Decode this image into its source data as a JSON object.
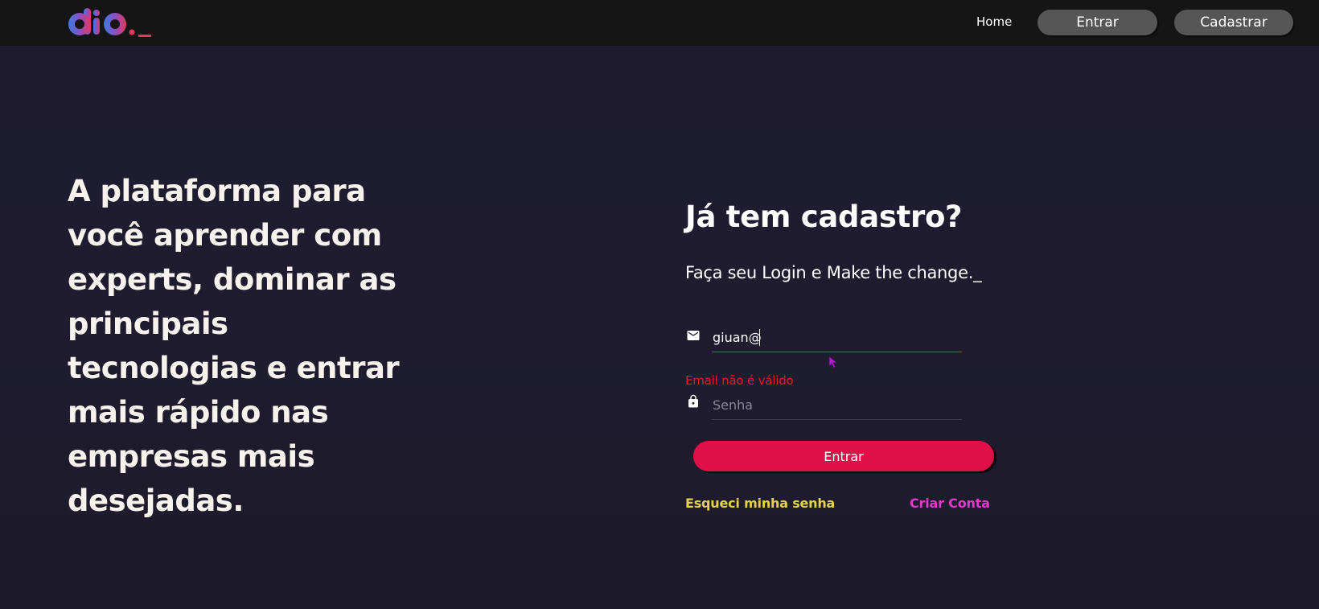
{
  "colors": {
    "background": "#1e1b31",
    "topbar": "#151515",
    "nav_button": "#565656",
    "primary_button": "#e11048",
    "error": "#e51a22",
    "forgot_link": "#e5d14d",
    "create_link": "#e13acf",
    "input_focus_underline": "#7e3dc2"
  },
  "header": {
    "logo_icon": "dio-logo",
    "nav": {
      "home_label": "Home",
      "login_label": "Entrar",
      "signup_label": "Cadastrar"
    }
  },
  "hero": {
    "headline": "A plataforma para você aprender com experts, dominar as principais tecnologias e entrar mais rápido nas empresas mais desejadas."
  },
  "login": {
    "title": "Já tem cadastro?",
    "subtitle": "Faça seu Login e Make the change._",
    "email": {
      "icon": "mail-icon",
      "value": "giuan@",
      "error": "Email não é válido"
    },
    "password": {
      "icon": "lock-icon",
      "placeholder": "Senha",
      "value": ""
    },
    "submit_label": "Entrar",
    "forgot_label": "Esqueci minha senha",
    "create_label": "Criar Conta"
  }
}
